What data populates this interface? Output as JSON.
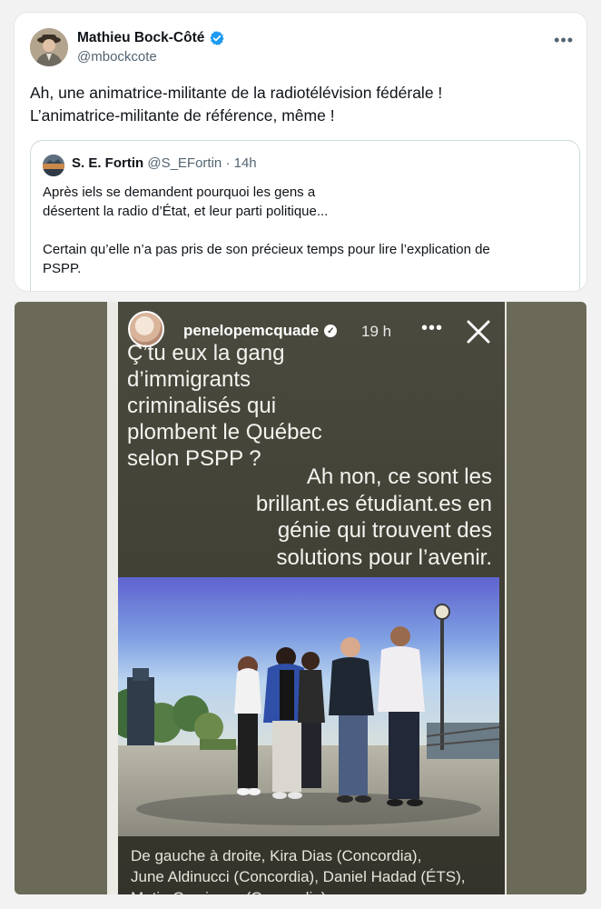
{
  "tweet": {
    "author_name": "Mathieu Bock-Côté",
    "author_handle": "@mbockcote",
    "more_label": "•••",
    "text_lines": [
      "Ah, une animatrice-militante de la radiotélévision fédérale !",
      "L’animatrice-militante de référence, même !"
    ],
    "colors": {
      "verified": "#1d9bf0",
      "secondary_text": "#536471"
    }
  },
  "quote": {
    "author_name": "S. E. Fortin",
    "author_handle": "@S_EFortin",
    "separator": "·",
    "time": "14h",
    "paragraph1": [
      "Après iels se demandent pourquoi les gens a",
      "désertent la radio d’État, et leur parti politique..."
    ],
    "paragraph2": [
      "Certain qu’elle n’a pas pris de son précieux temps pour lire l’explication de",
      "PSPP."
    ]
  },
  "story": {
    "username": "penelopemcquade",
    "time": "19 h",
    "more_label": "•••",
    "question_lines": [
      "Ç’tu eux la gang",
      "d’immigrants",
      "criminalisés qui",
      "plombent le Québec",
      "selon PSPP ?"
    ],
    "answer_lines": [
      "Ah non, ce sont les",
      "brillant.es étudiant.es en",
      "génie qui trouvent des",
      "solutions pour l’avenir."
    ],
    "caption_lines": [
      "De gauche à droite, Kira Dias (Concordia),",
      "June Aldinucci (Concordia), Daniel Hadad (ÉTS),",
      "Matia Comiezzo (Concordia)"
    ]
  }
}
